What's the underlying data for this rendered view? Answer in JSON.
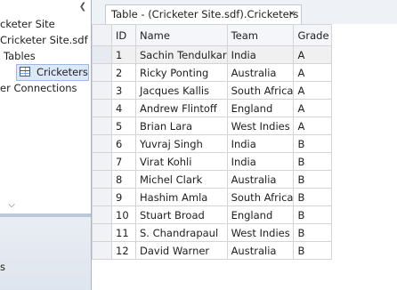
{
  "explorer": {
    "nodes": [
      {
        "label": "cketer Site"
      },
      {
        "label": "Cricketer Site.sdf"
      },
      {
        "label": "Tables"
      },
      {
        "label": "Cricketers"
      },
      {
        "label": "er Connections"
      }
    ],
    "bottom_label": "s"
  },
  "tab": {
    "title": "Table - (Cricketer Site.sdf).Cricketers",
    "close_glyph": "×"
  },
  "grid": {
    "columns": [
      "ID",
      "Name",
      "Team",
      "Grade"
    ],
    "rows": [
      [
        "1",
        "Sachin Tendulkar",
        "India",
        "A"
      ],
      [
        "2",
        "Ricky Ponting",
        "Australia",
        "A"
      ],
      [
        "3",
        "Jacques Kallis",
        "South Africa",
        "A"
      ],
      [
        "4",
        "Andrew Flintoff",
        "England",
        "A"
      ],
      [
        "5",
        "Brian Lara",
        "West Indies",
        "A"
      ],
      [
        "6",
        "Yuvraj Singh",
        "India",
        "B"
      ],
      [
        "7",
        "Virat Kohli",
        "India",
        "B"
      ],
      [
        "8",
        "Michel Clark",
        "Australia",
        "B"
      ],
      [
        "9",
        "Hashim Amla",
        "South Africa",
        "B"
      ],
      [
        "10",
        "Stuart Broad",
        "England",
        "B"
      ],
      [
        "11",
        "S. Chandrapaul",
        "West Indies",
        "B"
      ],
      [
        "12",
        "David Warner",
        "Australia",
        "B"
      ]
    ]
  },
  "icons": {
    "scroll_left": "chevron-left-icon",
    "scroll_down": "chevron-down-icon",
    "table": "table-icon",
    "close": "close-icon"
  },
  "colors": {
    "selection_fill": "#dce8f7",
    "selection_border": "#9cb9e4",
    "grid_line": "#d4d4d4",
    "selected_row": "#f0f0f0"
  }
}
